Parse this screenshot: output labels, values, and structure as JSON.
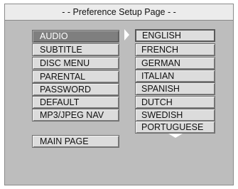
{
  "title": "- - Preference Setup Page - -",
  "menu": [
    {
      "label": "AUDIO",
      "selected": true
    },
    {
      "label": "SUBTITLE",
      "selected": false
    },
    {
      "label": "DISC MENU",
      "selected": false
    },
    {
      "label": "PARENTAL",
      "selected": false
    },
    {
      "label": "PASSWORD",
      "selected": false
    },
    {
      "label": "DEFAULT",
      "selected": false
    },
    {
      "label": "MP3/JPEG NAV",
      "selected": false
    }
  ],
  "main_page_label": "MAIN PAGE",
  "options": [
    {
      "label": "ENGLISH"
    },
    {
      "label": "FRENCH"
    },
    {
      "label": "GERMAN"
    },
    {
      "label": "ITALIAN"
    },
    {
      "label": "SPANISH"
    },
    {
      "label": "DUTCH"
    },
    {
      "label": "SWEDISH"
    },
    {
      "label": "PORTUGUESE"
    }
  ],
  "colors": {
    "background": "#bdbdbd",
    "title_bar": "#ececec",
    "button": "#dcdcdc",
    "selected_button": "#7f7f7f",
    "arrow": "#ffffff"
  },
  "icons": {
    "right_arrow": "right-arrow-icon",
    "scroll_down": "scroll-down-arrow-icon"
  }
}
